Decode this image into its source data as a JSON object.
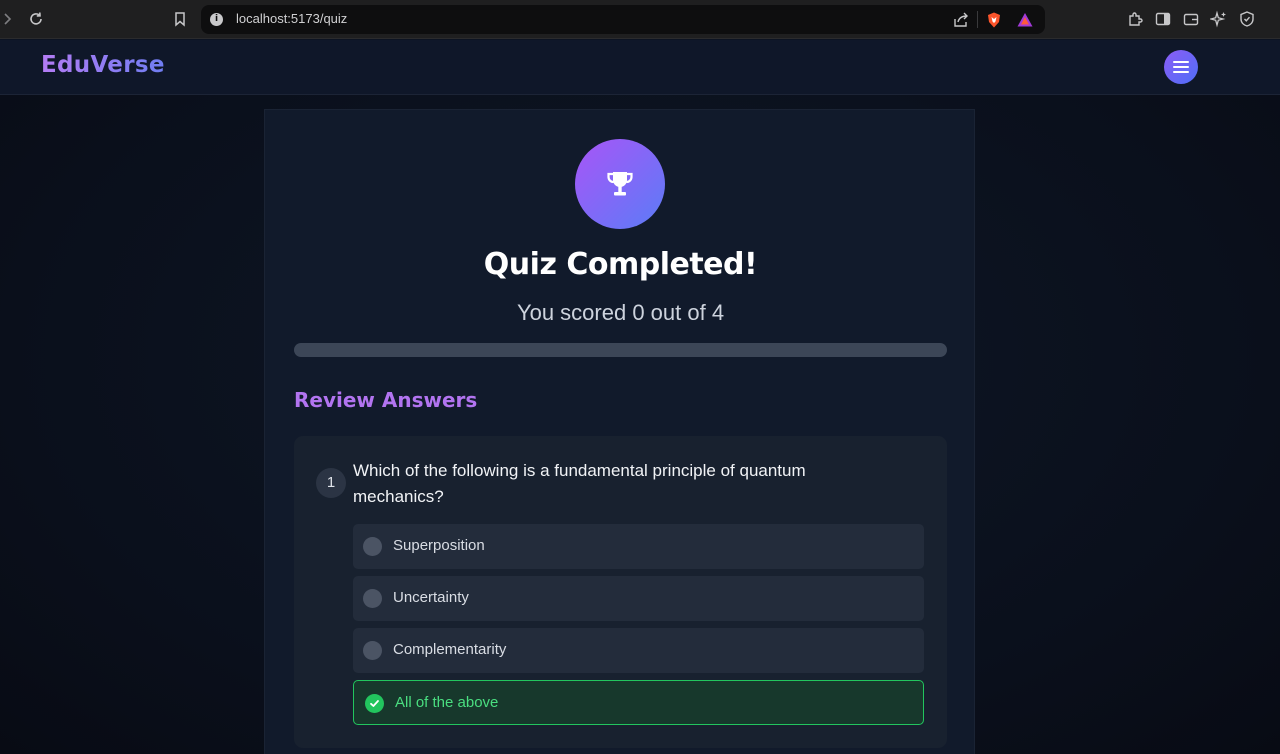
{
  "browser": {
    "url": "localhost:5173/quiz",
    "icons": [
      "forward-icon",
      "reload-icon",
      "bookmark-icon",
      "site-info-icon",
      "share-icon",
      "brave-shield-icon",
      "brave-rewards-icon",
      "extensions-icon",
      "sidebar-icon",
      "wallet-icon",
      "leo-ai-icon",
      "vpn-icon"
    ]
  },
  "header": {
    "brand": "EduVerse",
    "menu_icon": "hamburger-icon"
  },
  "result": {
    "icon": "trophy-icon",
    "title": "Quiz Completed!",
    "score_text": "You scored 0 out of 4",
    "score": 0,
    "total": 4,
    "progress_fraction": 0
  },
  "review": {
    "title": "Review Answers",
    "questions": [
      {
        "number": "1",
        "text": "Which of the following is a fundamental principle of quantum mechanics?",
        "options": [
          {
            "label": "Superposition",
            "state": "neutral"
          },
          {
            "label": "Uncertainty",
            "state": "neutral"
          },
          {
            "label": "Complementarity",
            "state": "neutral"
          },
          {
            "label": "All of the above",
            "state": "correct"
          }
        ]
      }
    ]
  },
  "colors": {
    "accent_purple": "#a855f7",
    "accent_blue": "#5b7cf7",
    "correct_green": "#22c55e",
    "card_bg": "#111a2b"
  }
}
